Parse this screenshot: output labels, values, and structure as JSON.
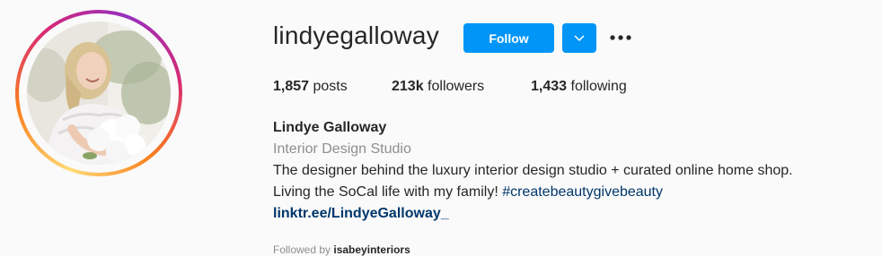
{
  "profile": {
    "username": "lindyegalloway",
    "follow_label": "Follow",
    "dropdown_icon": "chevron-down-icon",
    "more_icon": "more-options-icon",
    "stats": {
      "posts_count": "1,857",
      "posts_label": "posts",
      "followers_count": "213k",
      "followers_label": "followers",
      "following_count": "1,433",
      "following_label": "following"
    },
    "bio": {
      "full_name": "Lindye Galloway",
      "category": "Interior Design Studio",
      "line1": "The designer behind the luxury interior design studio + curated online home shop.",
      "line2": "Living the SoCal life with my family! ",
      "hashtag": "#createbeautygivebeauty",
      "link": "linktr.ee/LindyeGalloway_"
    },
    "followed_by": {
      "prefix": "Followed by ",
      "user": "isabeyinteriors"
    }
  },
  "colors": {
    "primary_button": "#0095f6",
    "link": "#00376b",
    "secondary_text": "#8e8e8e",
    "text": "#262626",
    "background": "#fafafa"
  }
}
